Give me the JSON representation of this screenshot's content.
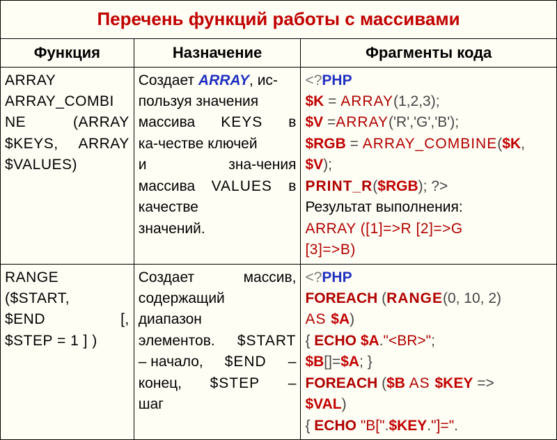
{
  "title": "Перечень функций работы с массивами",
  "headers": {
    "func": "Функция",
    "desc": "Назначение",
    "code": "Фрагменты кода"
  },
  "rows": [
    {
      "func": {
        "l1": "ARRAY",
        "l2": "ARRAY_COMBI",
        "l3_a": "NE",
        "l3_b": "(ARRAY",
        "l4_a": "$KEYS,",
        "l4_b": "ARRAY",
        "l5": "$VALUES)"
      },
      "desc": {
        "p1a": "Создает ",
        "p1b": "ARRAY",
        "p1c": ", ис-",
        "p2": "пользуя значения",
        "p3a": "массива",
        "p3b": "KEYS",
        "p3c": "в",
        "p4": "ка-честве ключей",
        "p5a": "и",
        "p5b": "зна-чения",
        "p6a": "массива",
        "p6b": "VALUES",
        "p6c": "в",
        "p7": "качестве",
        "p8": "значений."
      },
      "code": {
        "open": "<?",
        "php": "PHP",
        "l2_var": "$K",
        "l2_eq": " = ",
        "l2_fn": "ARRAY",
        "l2_args": "(1,2,3);",
        "l3_var": "$V",
        "l3_eq": " =",
        "l3_fn": "ARRAY",
        "l3_args": "('R','G','B');",
        "l4_var": "$RGB",
        "l4_eq": " = ",
        "l4_fn": "ARRAY_COMBINE",
        "l4_open": "(",
        "l4_a1": "$K",
        "l4_comma": ",",
        "l5_a2": "$V",
        "l5_close": ");",
        "l6_fn": "PRINT_R",
        "l6_open": "(",
        "l6_arg": "$RGB",
        "l6_close": "); ?>",
        "res_label": "Результат выполнения:",
        "res_l1": "ARRAY ([1]=>R [2]=>G",
        "res_l2": "[3]=>B)"
      }
    },
    {
      "func": {
        "l1": "RANGE",
        "l2": "($START,",
        "l3_a": "$END",
        "l3_b": "[,",
        "l4": "$STEP = 1 ] )"
      },
      "desc": {
        "p1a": "Создает",
        "p1b": "массив,",
        "p2": "содержащий",
        "p3": "диапазон",
        "p4a": "элементов.",
        "p4b": "$START",
        "p5a": "– начало,",
        "p5b": "$END",
        "p5c": "–",
        "p6a": "конец,",
        "p6b": "$STEP",
        "p6c": "–",
        "p7": "шаг"
      },
      "code": {
        "open": "<?",
        "php": "PHP",
        "l2_kw": "FOREACH",
        "l2_open": " (",
        "l2_fn": "RANGE",
        "l2_args": "(0, 10, 2)",
        "l3_as": "AS ",
        "l3_var": "$A",
        "l3_close": ")",
        "l4_open": "{  ",
        "l4_kw": "ECHO",
        "l4_sp": " ",
        "l4_var": "$A",
        "l4_dot": ".",
        "l4_str": "\"<BR>\"",
        "l4_semi": ";",
        "l5_var": "$B",
        "l5_idx": "[]=",
        "l5_var2": "$A",
        "l5_end": ";  }",
        "l6_kw": "FOREACH",
        "l6_open": " (",
        "l6_var": "$B",
        "l6_as": " AS ",
        "l6_key": "$KEY",
        "l6_arrow": " =>",
        "l7_var": "$VAL",
        "l7_close": ")",
        "l8_open": "{ ",
        "l8_kw": "ECHO",
        "l8_sp": " ",
        "l8_str1": "\"B[\"",
        "l8_dot1": ".",
        "l8_key": "$KEY",
        "l8_dot2": ".",
        "l8_str2": "\"]=\"",
        "l8_dot3": "."
      }
    }
  ]
}
